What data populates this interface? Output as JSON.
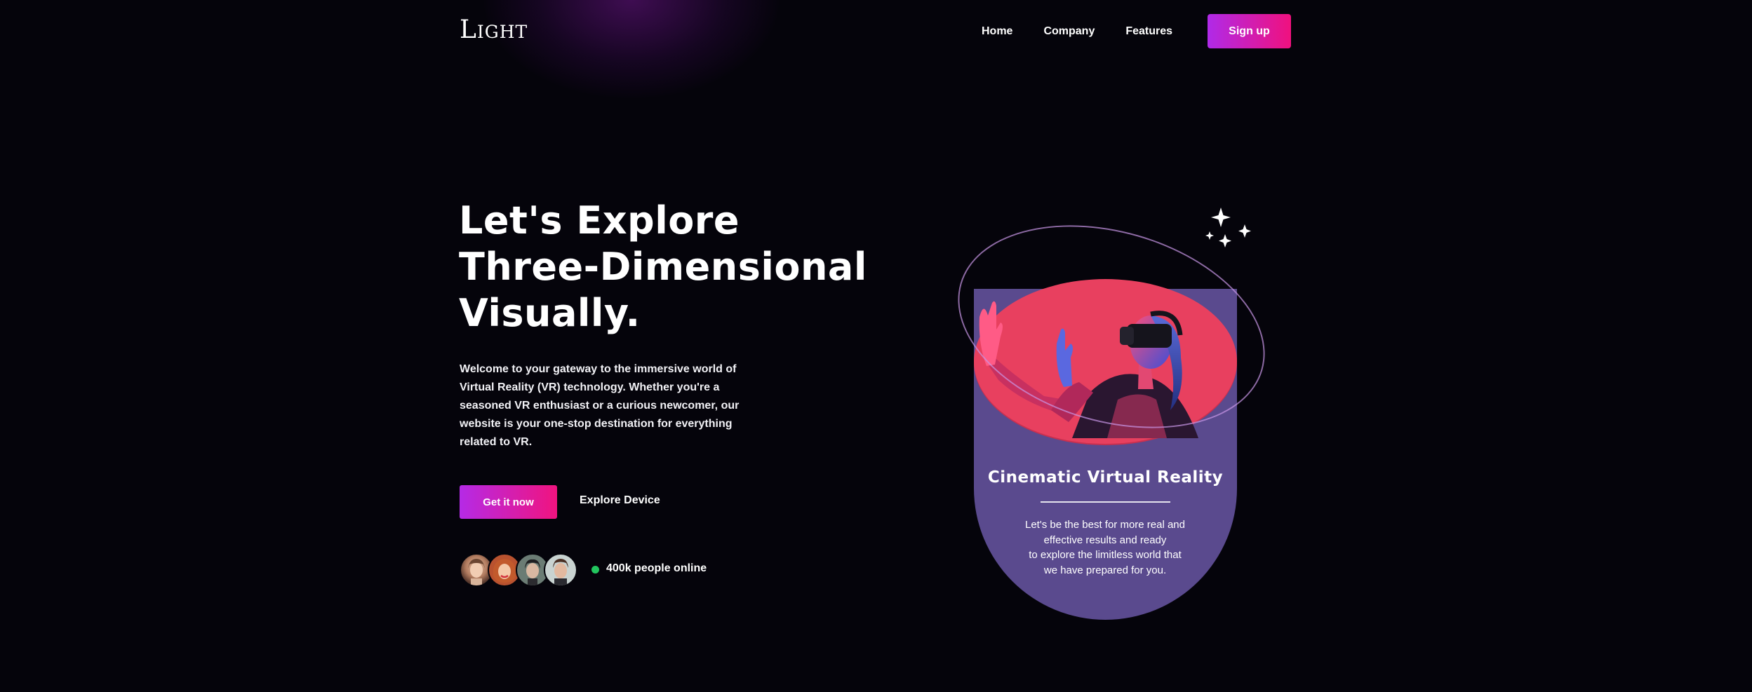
{
  "nav": {
    "logo": "Light",
    "links": [
      "Home",
      "Company",
      "Features"
    ],
    "signup_label": "Sign up"
  },
  "hero": {
    "title_lines": [
      "Let's Explore",
      "Three-Dimensional",
      "Visually."
    ],
    "description": "Welcome to your gateway to the immersive world of Virtual Reality (VR) technology. Whether you're a seasoned VR enthusiast or a curious newcomer, our website is your one-stop destination for everything related to VR.",
    "cta_label": "Get it now",
    "secondary_label": "Explore Device",
    "online_text": "400k people online"
  },
  "card": {
    "title": "Cinematic Virtual Reality",
    "text_lines": [
      "Let's be the best for more real and",
      "effective results and ready",
      "to explore the limitless world that",
      "we have prepared for you."
    ]
  },
  "colors": {
    "background": "#05040b",
    "accent_start": "#b52ae6",
    "accent_end": "#f0147f",
    "card_purple": "#5a4a8e",
    "card_pink": "#e8405f",
    "online_green": "#22c55e"
  },
  "icons": [
    "sparkles-icon",
    "online-status-dot"
  ]
}
